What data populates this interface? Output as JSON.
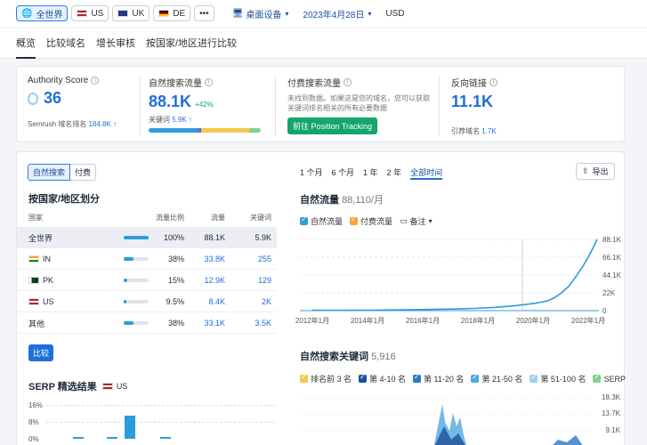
{
  "topbar": {
    "pills": [
      {
        "label": "全世界",
        "icon": "globe-icon"
      },
      {
        "label": "US"
      },
      {
        "label": "UK"
      },
      {
        "label": "DE"
      },
      {
        "label": "•••"
      }
    ],
    "device": "桌面设备",
    "date": "2023年4月28日",
    "currency": "USD"
  },
  "nav": [
    "概览",
    "比较域名",
    "增长审核",
    "按国家/地区进行比较"
  ],
  "metrics": {
    "authority": {
      "label": "Authority Score",
      "value": "36",
      "rank_label": "Semrush 域名排名",
      "rank_value": "184.8K ↑"
    },
    "organic": {
      "label": "自然搜索流量",
      "value": "88.1K",
      "delta": "+42%",
      "kw_label": "关键词",
      "kw_value": "5.9K ↑"
    },
    "paid": {
      "label": "付费搜索流量",
      "desc": "未找到数据。如果这是您的域名，您可以获取关键词排名相关的所有必要数据",
      "button": "前往 Position Tracking"
    },
    "backlinks": {
      "label": "反向链接",
      "value": "11.1K",
      "ref_label": "引荐域名",
      "ref_value": "1.7K"
    }
  },
  "left": {
    "toggle": [
      "自然搜索",
      "付费"
    ],
    "section_title": "按国家/地区划分",
    "headers": [
      "国家",
      "流量比例",
      "流量",
      "关键词"
    ],
    "rows": [
      {
        "country": "全世界",
        "share": "100%",
        "share_frac": 1.0,
        "traffic": "88.1K",
        "keywords": "5.9K",
        "flag": "none"
      },
      {
        "country": "IN",
        "share": "38%",
        "share_frac": 0.38,
        "traffic": "33.8K",
        "keywords": "255",
        "flag": "in"
      },
      {
        "country": "PK",
        "share": "15%",
        "share_frac": 0.15,
        "traffic": "12.9K",
        "keywords": "129",
        "flag": "pk"
      },
      {
        "country": "US",
        "share": "9.5%",
        "share_frac": 0.095,
        "traffic": "8.4K",
        "keywords": "2K",
        "flag": "us"
      },
      {
        "country": "其他",
        "share": "38%",
        "share_frac": 0.38,
        "traffic": "33.1K",
        "keywords": "3.5K",
        "flag": "none"
      }
    ],
    "compare_button": "比较",
    "serp_title": "SERP 精选结果",
    "serp_country": "US",
    "serp_ticks": [
      "16%",
      "8%",
      "0%"
    ]
  },
  "right": {
    "ranges": [
      "1 个月",
      "6 个月",
      "1 年",
      "2 年",
      "全部时间"
    ],
    "export": "导出",
    "traffic_title": "自然流量",
    "traffic_value": "88,110/月",
    "legend": [
      "自然流量",
      "付费流量",
      "备注"
    ],
    "kw_title": "自然搜索关键词",
    "kw_value": "5,916",
    "kw_legend": [
      "排名前 3 名",
      "第 4-10 名",
      "第 11-20 名",
      "第 21-50 名",
      "第 51-100 名",
      "SERP"
    ],
    "kw_ticks": [
      "18.3K",
      "13.7K",
      "9.1K"
    ]
  },
  "chart_data": {
    "type": "line",
    "title": "自然流量",
    "x": [
      "2012年1月",
      "2014年1月",
      "2016年1月",
      "2018年1月",
      "2020年1月",
      "2022年1月"
    ],
    "ylim": [
      0,
      88100
    ],
    "yticks": [
      "88.1K",
      "66.1K",
      "44.1K",
      "22K",
      "0"
    ],
    "series": [
      {
        "name": "自然流量",
        "values": [
          400,
          300,
          500,
          600,
          900,
          1200,
          1500,
          2000,
          2800,
          4000,
          6000,
          9000,
          12000,
          16000,
          22000,
          30000,
          42000,
          55000,
          70000,
          88100
        ]
      }
    ],
    "color": "#2d9cdb",
    "grid": true
  },
  "colors": {
    "accent": "#1f6fd6",
    "green": "#13a56b",
    "organic": "#2d9cdb",
    "paid": "#f5a33a"
  }
}
